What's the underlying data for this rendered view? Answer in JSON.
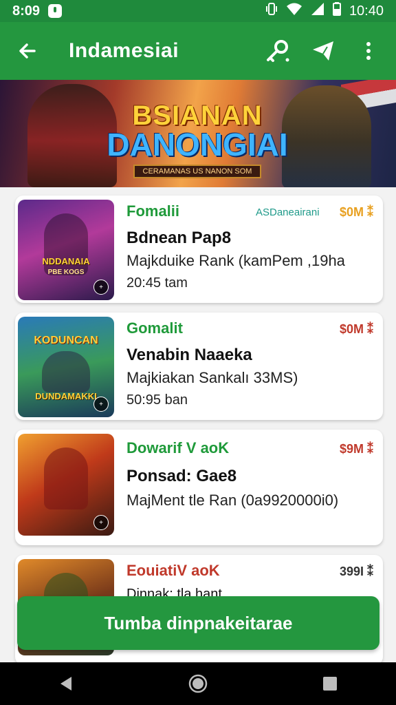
{
  "status_bar": {
    "time": "8:09",
    "clock": "10:40"
  },
  "app_bar": {
    "title": "Indamesiai"
  },
  "banner": {
    "line1": "BSIANAN",
    "line2": "DANONGIAI",
    "ribbon": "CERAMANAS US NANON SOM"
  },
  "items": [
    {
      "category": "Fomalii",
      "tag": "ASDaneairani",
      "price": "$0M ⁑",
      "name": "Bdnean Pap8",
      "desc": "Majkduike Rank (kamPem ,19ha",
      "time": "20:45 tam",
      "thumb_top": "",
      "thumb_label": "NDDANAIA",
      "thumb_sub": "PBE KOGS",
      "category_color": "#1f9a3a",
      "price_color": "#e8a020"
    },
    {
      "category": "Gomalit",
      "tag": "",
      "price": "$0M ⁑",
      "name": "Venabin Naaeka",
      "desc": "Majkiakan Sankalı 33MS)",
      "time": "50:95 ban",
      "thumb_top": "KODUNCAN",
      "thumb_label": "DUNDAMAKKI",
      "thumb_sub": "",
      "category_color": "#1f9a3a",
      "price_color": "#c0392b"
    },
    {
      "category": "Dowarif V aoK",
      "tag": "",
      "price": "$9M ⁑",
      "name": "Ponsad: Gae8",
      "desc": "MajMent tle Ran (0a9920000i0)",
      "time": "",
      "thumb_top": "",
      "thumb_label": "",
      "thumb_sub": "",
      "category_color": "#1f9a3a",
      "price_color": "#c0392b"
    },
    {
      "category": "EouiatiV aoK",
      "tag": "",
      "price": "399I ⁑",
      "name": "Dinnak: tla hant",
      "desc": "",
      "time": "",
      "thumb_top": "",
      "thumb_label": "",
      "thumb_sub": "",
      "category_color": "#c0392b",
      "price_color": "#333333"
    }
  ],
  "cta": {
    "label": "Tumba dinpnakeitarae"
  },
  "colors": {
    "primary": "#24973f",
    "status": "#1f8a3c"
  },
  "icons": [
    "back-arrow-icon",
    "key-icon",
    "send-icon",
    "more-vert-icon",
    "nav-back-icon",
    "nav-home-icon",
    "nav-recents-icon"
  ]
}
